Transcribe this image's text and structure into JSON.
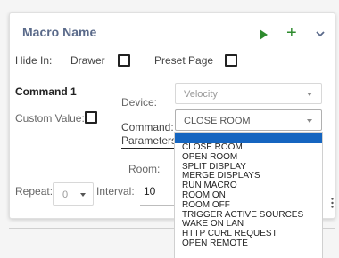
{
  "header": {
    "title": "Macro Name",
    "play_icon": "play-icon",
    "add_icon": "plus-icon",
    "collapse_icon": "chevron-down-icon",
    "accent_color": "#2e8b2e",
    "add_label": "+"
  },
  "hide_in": {
    "label": "Hide In:",
    "drawer_label": "Drawer",
    "preset_page_label": "Preset Page"
  },
  "command": {
    "section_label": "Command 1",
    "device_label": "Device:",
    "device_value": "Velocity",
    "custom_value_label": "Custom Value:",
    "command_label": "Command:",
    "command_value": "CLOSE ROOM",
    "parameters_label": "Parameters:",
    "room_label": "Room:"
  },
  "repeat": {
    "label": "Repeat:",
    "value": "0",
    "interval_label": "Interval:",
    "interval_value": "10"
  },
  "command_options": [
    "CLOSE ROOM",
    "OPEN ROOM",
    "SPLIT DISPLAY",
    "MERGE DISPLAYS",
    "RUN MACRO",
    "ROOM ON",
    "ROOM OFF",
    "TRIGGER ACTIVE SOURCES",
    "WAKE ON LAN",
    "HTTP CURL REQUEST",
    "OPEN REMOTE"
  ],
  "highlight_color": "#1565c0"
}
